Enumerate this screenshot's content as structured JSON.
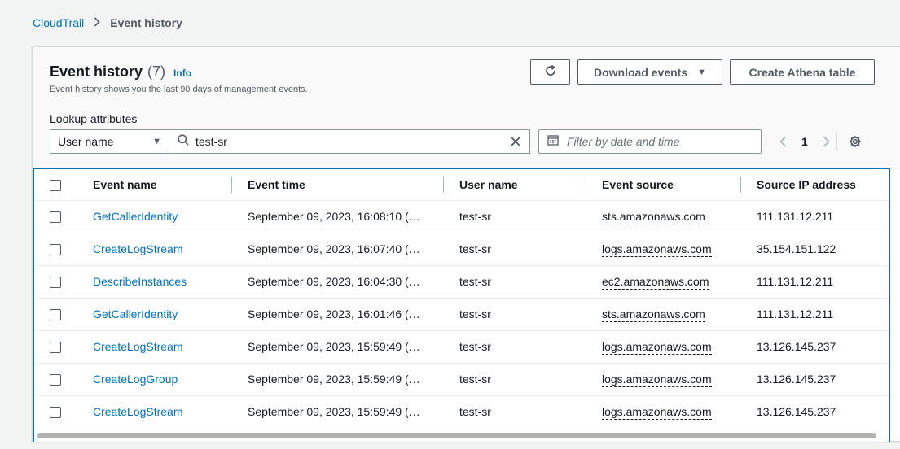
{
  "breadcrumb": {
    "root": "CloudTrail",
    "current": "Event history"
  },
  "header": {
    "title": "Event history",
    "count": "(7)",
    "info": "Info",
    "subtitle": "Event history shows you the last 90 days of management events."
  },
  "toolbar": {
    "download_label": "Download events",
    "athena_label": "Create Athena table"
  },
  "lookup": {
    "label": "Lookup attributes",
    "attribute": "User name",
    "value": "test-sr",
    "date_placeholder": "Filter by date and time"
  },
  "pagination": {
    "current_page": "1"
  },
  "table": {
    "columns": [
      "Event name",
      "Event time",
      "User name",
      "Event source",
      "Source IP address"
    ],
    "rows": [
      [
        "GetCallerIdentity",
        "September 09, 2023, 16:08:10 (…",
        "test-sr",
        "sts.amazonaws.com",
        "111.131.12.211"
      ],
      [
        "CreateLogStream",
        "September 09, 2023, 16:07:40 (…",
        "test-sr",
        "logs.amazonaws.com",
        "35.154.151.122"
      ],
      [
        "DescribeInstances",
        "September 09, 2023, 16:04:30 (…",
        "test-sr",
        "ec2.amazonaws.com",
        "111.131.12.211"
      ],
      [
        "GetCallerIdentity",
        "September 09, 2023, 16:01:46 (…",
        "test-sr",
        "sts.amazonaws.com",
        "111.131.12.211"
      ],
      [
        "CreateLogStream",
        "September 09, 2023, 15:59:49 (…",
        "test-sr",
        "logs.amazonaws.com",
        "13.126.145.237"
      ],
      [
        "CreateLogGroup",
        "September 09, 2023, 15:59:49 (…",
        "test-sr",
        "logs.amazonaws.com",
        "13.126.145.237"
      ],
      [
        "CreateLogStream",
        "September 09, 2023, 15:59:49 (…",
        "test-sr",
        "logs.amazonaws.com",
        "13.126.145.237"
      ]
    ]
  },
  "colors": {
    "link": "#0073bb",
    "text": "#16191f",
    "muted": "#545b64",
    "background": "#f2f3f3"
  }
}
